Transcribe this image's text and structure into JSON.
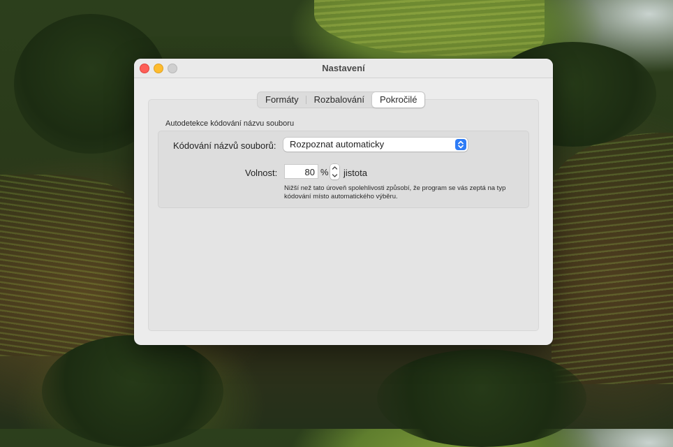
{
  "window": {
    "title": "Nastavení"
  },
  "tabs": [
    {
      "label": "Formáty",
      "active": false
    },
    {
      "label": "Rozbalování",
      "active": false
    },
    {
      "label": "Pokročilé",
      "active": true
    }
  ],
  "autodetect": {
    "group_label": "Autodetekce kódování názvu souboru",
    "encoding_label": "Kódování názvů souborů:",
    "encoding_value": "Rozpoznat automaticky",
    "tolerance_label": "Volnost:",
    "tolerance_value": "80",
    "tolerance_unit": "%",
    "tolerance_suffix": "jistota",
    "hint": "Nižší než tato úroveň spolehlivosti způsobí, že program se vás zeptá na typ kódování místo automatického výběru."
  },
  "colors": {
    "accent": "#2e7cf6",
    "close": "#fe5f57",
    "minimize": "#febc2e",
    "zoom_disabled": "#cfcfcf"
  },
  "icons": {
    "select_arrows": "chevron-up-down-icon",
    "stepper": "stepper-arrows-icon"
  }
}
